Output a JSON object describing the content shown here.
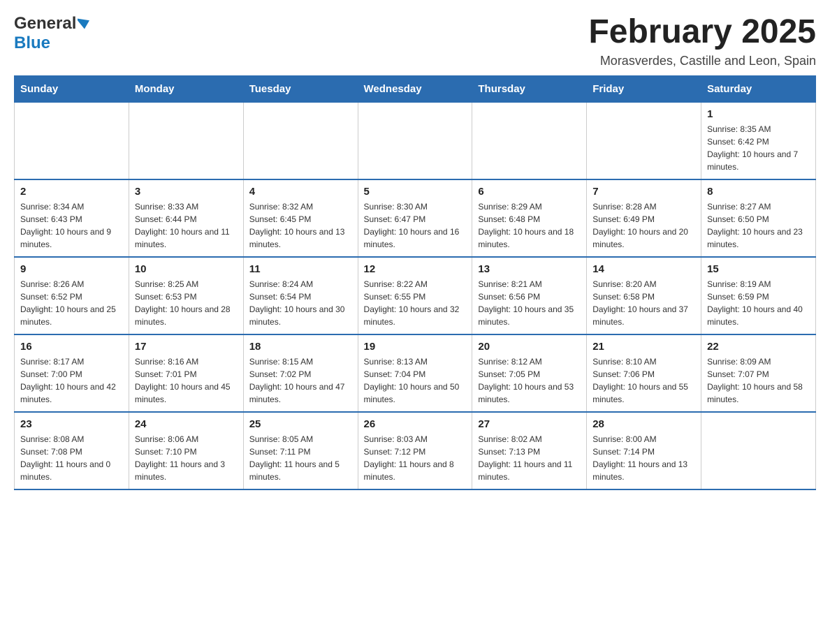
{
  "header": {
    "logo_general": "General",
    "logo_blue": "Blue",
    "month_title": "February 2025",
    "subtitle": "Morasverdes, Castille and Leon, Spain"
  },
  "days_of_week": [
    "Sunday",
    "Monday",
    "Tuesday",
    "Wednesday",
    "Thursday",
    "Friday",
    "Saturday"
  ],
  "weeks": [
    [
      {
        "day": "",
        "info": ""
      },
      {
        "day": "",
        "info": ""
      },
      {
        "day": "",
        "info": ""
      },
      {
        "day": "",
        "info": ""
      },
      {
        "day": "",
        "info": ""
      },
      {
        "day": "",
        "info": ""
      },
      {
        "day": "1",
        "info": "Sunrise: 8:35 AM\nSunset: 6:42 PM\nDaylight: 10 hours and 7 minutes."
      }
    ],
    [
      {
        "day": "2",
        "info": "Sunrise: 8:34 AM\nSunset: 6:43 PM\nDaylight: 10 hours and 9 minutes."
      },
      {
        "day": "3",
        "info": "Sunrise: 8:33 AM\nSunset: 6:44 PM\nDaylight: 10 hours and 11 minutes."
      },
      {
        "day": "4",
        "info": "Sunrise: 8:32 AM\nSunset: 6:45 PM\nDaylight: 10 hours and 13 minutes."
      },
      {
        "day": "5",
        "info": "Sunrise: 8:30 AM\nSunset: 6:47 PM\nDaylight: 10 hours and 16 minutes."
      },
      {
        "day": "6",
        "info": "Sunrise: 8:29 AM\nSunset: 6:48 PM\nDaylight: 10 hours and 18 minutes."
      },
      {
        "day": "7",
        "info": "Sunrise: 8:28 AM\nSunset: 6:49 PM\nDaylight: 10 hours and 20 minutes."
      },
      {
        "day": "8",
        "info": "Sunrise: 8:27 AM\nSunset: 6:50 PM\nDaylight: 10 hours and 23 minutes."
      }
    ],
    [
      {
        "day": "9",
        "info": "Sunrise: 8:26 AM\nSunset: 6:52 PM\nDaylight: 10 hours and 25 minutes."
      },
      {
        "day": "10",
        "info": "Sunrise: 8:25 AM\nSunset: 6:53 PM\nDaylight: 10 hours and 28 minutes."
      },
      {
        "day": "11",
        "info": "Sunrise: 8:24 AM\nSunset: 6:54 PM\nDaylight: 10 hours and 30 minutes."
      },
      {
        "day": "12",
        "info": "Sunrise: 8:22 AM\nSunset: 6:55 PM\nDaylight: 10 hours and 32 minutes."
      },
      {
        "day": "13",
        "info": "Sunrise: 8:21 AM\nSunset: 6:56 PM\nDaylight: 10 hours and 35 minutes."
      },
      {
        "day": "14",
        "info": "Sunrise: 8:20 AM\nSunset: 6:58 PM\nDaylight: 10 hours and 37 minutes."
      },
      {
        "day": "15",
        "info": "Sunrise: 8:19 AM\nSunset: 6:59 PM\nDaylight: 10 hours and 40 minutes."
      }
    ],
    [
      {
        "day": "16",
        "info": "Sunrise: 8:17 AM\nSunset: 7:00 PM\nDaylight: 10 hours and 42 minutes."
      },
      {
        "day": "17",
        "info": "Sunrise: 8:16 AM\nSunset: 7:01 PM\nDaylight: 10 hours and 45 minutes."
      },
      {
        "day": "18",
        "info": "Sunrise: 8:15 AM\nSunset: 7:02 PM\nDaylight: 10 hours and 47 minutes."
      },
      {
        "day": "19",
        "info": "Sunrise: 8:13 AM\nSunset: 7:04 PM\nDaylight: 10 hours and 50 minutes."
      },
      {
        "day": "20",
        "info": "Sunrise: 8:12 AM\nSunset: 7:05 PM\nDaylight: 10 hours and 53 minutes."
      },
      {
        "day": "21",
        "info": "Sunrise: 8:10 AM\nSunset: 7:06 PM\nDaylight: 10 hours and 55 minutes."
      },
      {
        "day": "22",
        "info": "Sunrise: 8:09 AM\nSunset: 7:07 PM\nDaylight: 10 hours and 58 minutes."
      }
    ],
    [
      {
        "day": "23",
        "info": "Sunrise: 8:08 AM\nSunset: 7:08 PM\nDaylight: 11 hours and 0 minutes."
      },
      {
        "day": "24",
        "info": "Sunrise: 8:06 AM\nSunset: 7:10 PM\nDaylight: 11 hours and 3 minutes."
      },
      {
        "day": "25",
        "info": "Sunrise: 8:05 AM\nSunset: 7:11 PM\nDaylight: 11 hours and 5 minutes."
      },
      {
        "day": "26",
        "info": "Sunrise: 8:03 AM\nSunset: 7:12 PM\nDaylight: 11 hours and 8 minutes."
      },
      {
        "day": "27",
        "info": "Sunrise: 8:02 AM\nSunset: 7:13 PM\nDaylight: 11 hours and 11 minutes."
      },
      {
        "day": "28",
        "info": "Sunrise: 8:00 AM\nSunset: 7:14 PM\nDaylight: 11 hours and 13 minutes."
      },
      {
        "day": "",
        "info": ""
      }
    ]
  ]
}
